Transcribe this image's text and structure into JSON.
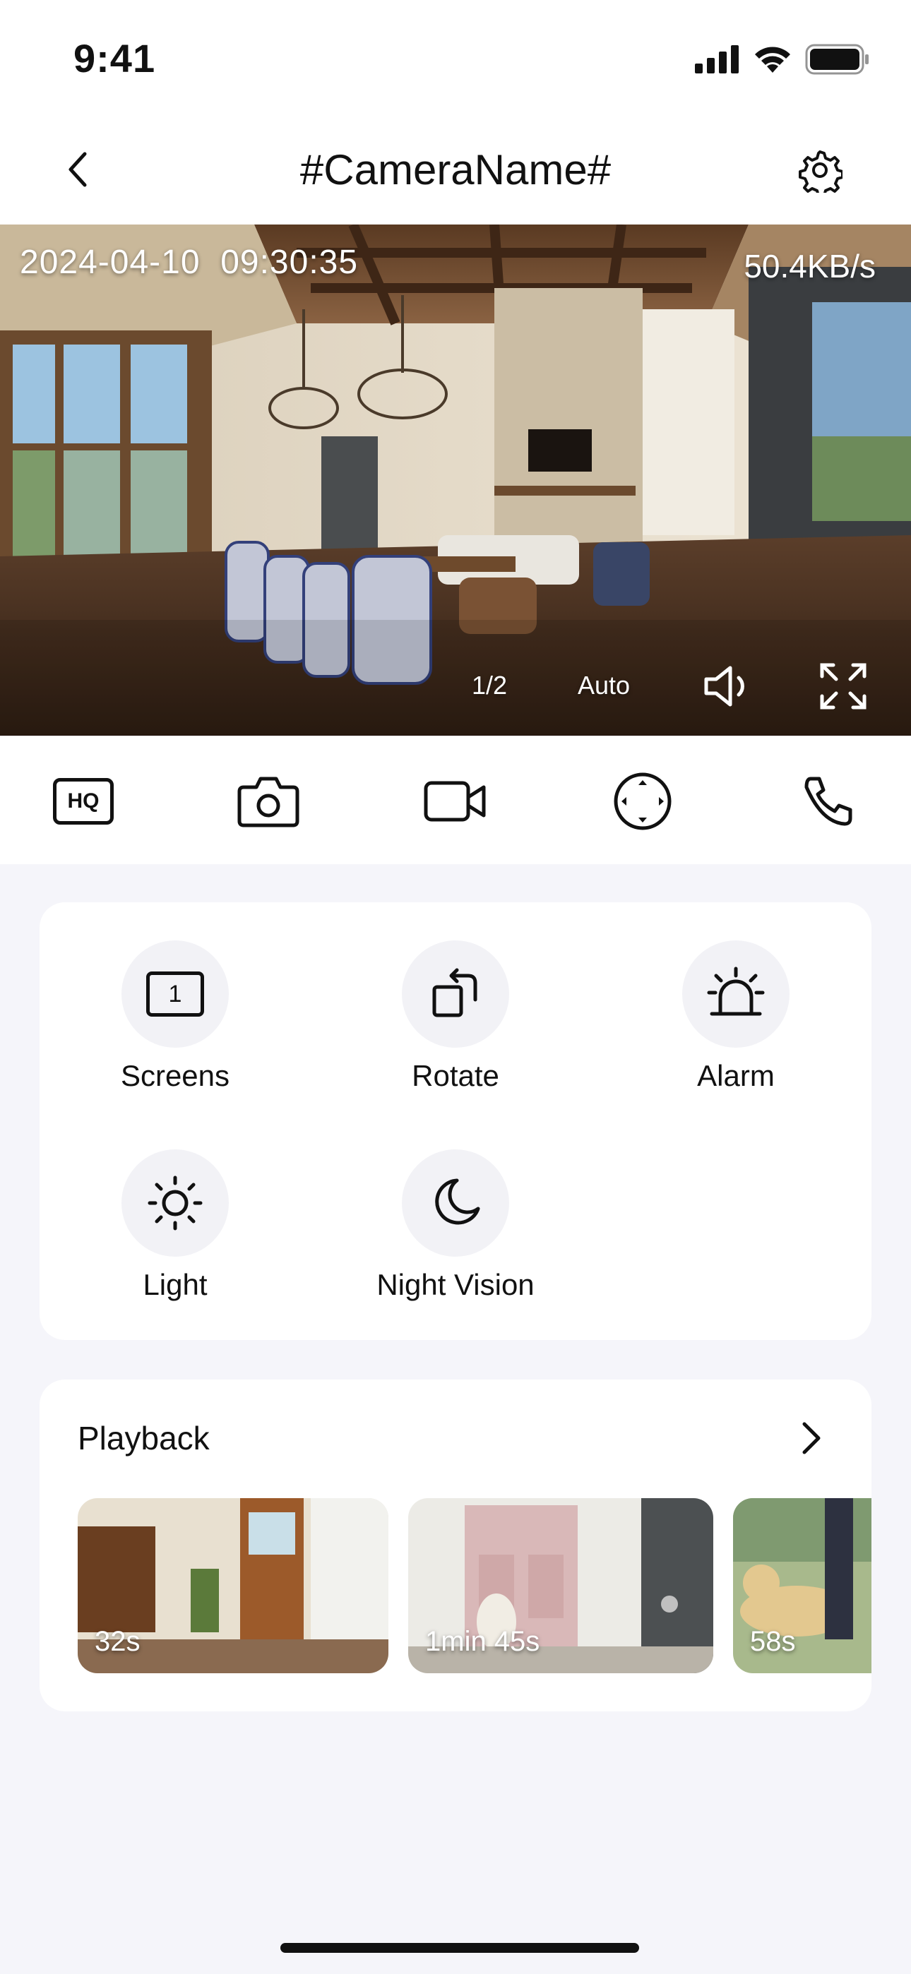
{
  "status_bar": {
    "time": "9:41"
  },
  "nav": {
    "title": "#CameraName#"
  },
  "video": {
    "timestamp": "2024-04-10  09:30:35",
    "bitrate": "50.4KB/s",
    "page": "1/2",
    "quality": "Auto"
  },
  "toolbar": {
    "items": [
      {
        "label": "HQ",
        "icon": "hq-icon"
      },
      {
        "icon": "camera-icon"
      },
      {
        "icon": "video-record-icon"
      },
      {
        "icon": "ptz-direction-icon"
      },
      {
        "icon": "phone-call-icon"
      }
    ]
  },
  "features": [
    {
      "label": "Screens",
      "icon": "screens-icon",
      "badge": "1"
    },
    {
      "label": "Rotate",
      "icon": "rotate-icon"
    },
    {
      "label": "Alarm",
      "icon": "alarm-icon"
    },
    {
      "label": "Light",
      "icon": "sun-icon"
    },
    {
      "label": "Night Vision",
      "icon": "moon-icon"
    }
  ],
  "playback": {
    "title": "Playback",
    "clips": [
      {
        "duration": "32s"
      },
      {
        "duration": "1min 45s"
      },
      {
        "duration": "58s"
      }
    ]
  },
  "colors": {
    "accent": "#111111",
    "background": "#f5f5fa",
    "card": "#ffffff"
  }
}
